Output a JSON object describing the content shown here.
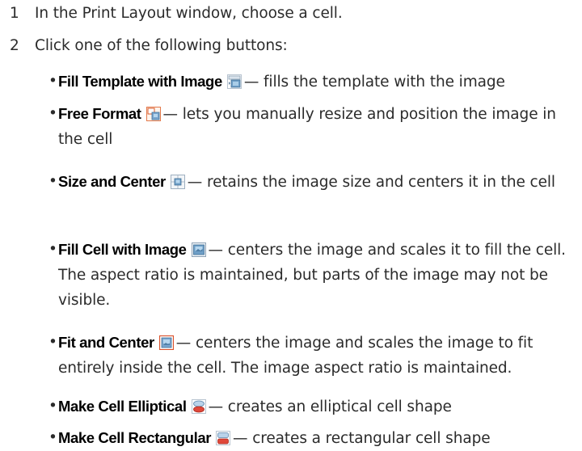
{
  "steps": [
    {
      "number": "1",
      "text": "In the Print Layout window, choose a cell."
    },
    {
      "number": "2",
      "text": "Click one of the following buttons:"
    }
  ],
  "options": [
    {
      "term": "Fill Template with Image",
      "icon": "fill-template-icon",
      "description": "— fills the template with the image"
    },
    {
      "term": "Free Format",
      "icon": "free-format-icon",
      "description": "— lets you manually resize and position the image in the cell"
    },
    {
      "term": "Size and Center",
      "icon": "size-and-center-icon",
      "description": "— retains the image size and centers it in the cell"
    },
    {
      "term": "Fill Cell with Image",
      "icon": "fill-cell-icon",
      "description": "— centers the image and scales it to fill the cell. The aspect ratio is maintained, but parts of the image may not be visible."
    },
    {
      "term": "Fit and Center",
      "icon": "fit-and-center-icon",
      "description": "— centers the image and scales the image to fit entirely inside the cell. The image aspect ratio is maintained."
    },
    {
      "term": "Make Cell Elliptical",
      "icon": "make-cell-elliptical-icon",
      "description": "— creates an elliptical cell shape"
    },
    {
      "term": "Make Cell Rectangular",
      "icon": "make-cell-rectangular-icon",
      "description": "— creates a rectangular cell shape"
    }
  ],
  "bullet_glyph": "•"
}
